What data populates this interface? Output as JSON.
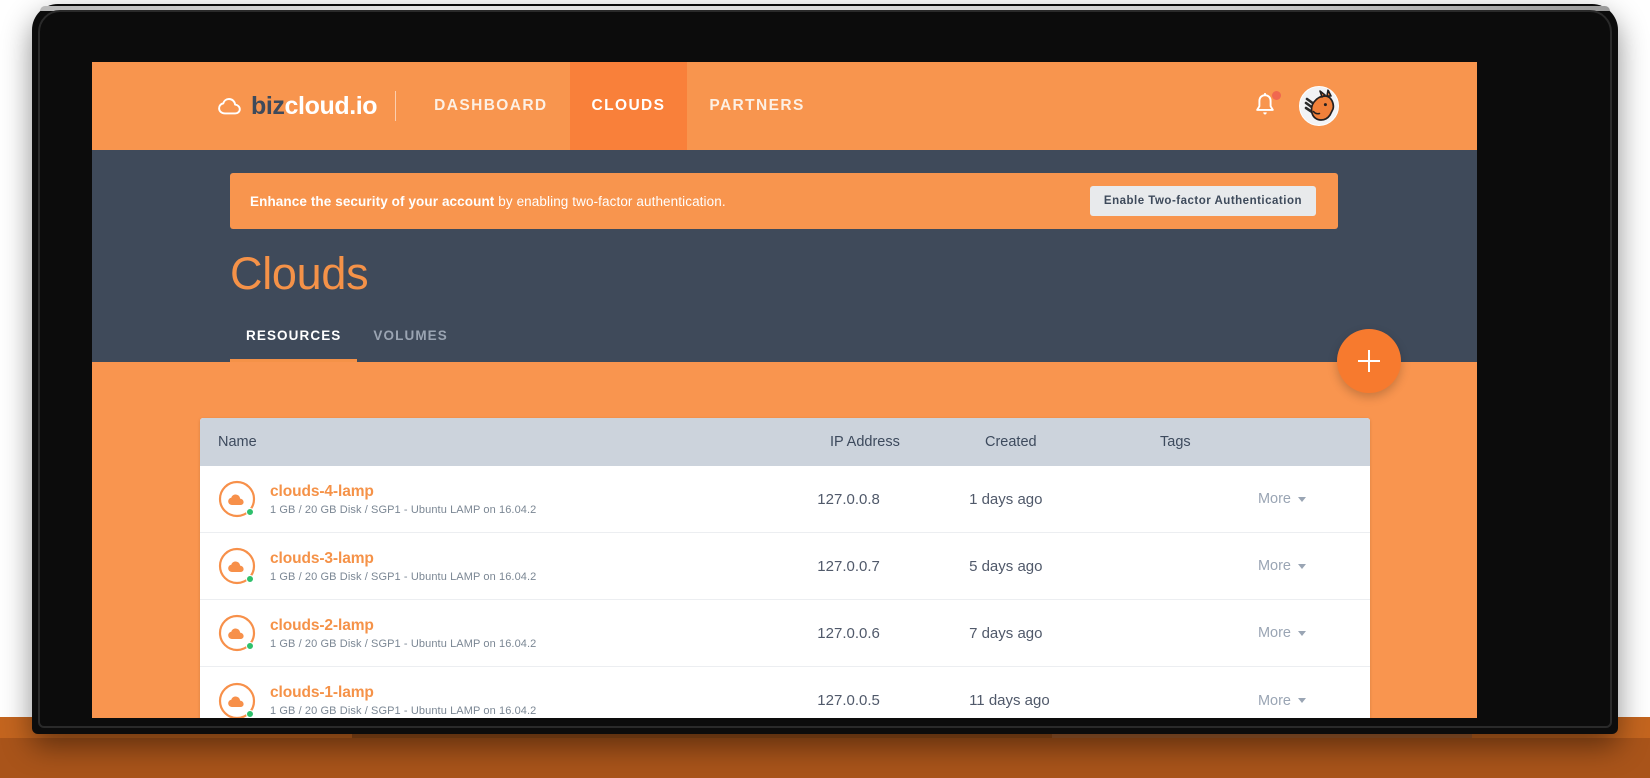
{
  "brand": {
    "mark": "cloud-outline-icon",
    "text_dark": "biz",
    "text_light": "cloud.io"
  },
  "nav": {
    "items": [
      {
        "label": "DASHBOARD",
        "active": false
      },
      {
        "label": "CLOUDS",
        "active": true
      },
      {
        "label": "PARTNERS",
        "active": false
      }
    ],
    "bell_icon": "bell-icon",
    "bell_has_badge": true,
    "avatar_alt": "horse-avatar"
  },
  "banner": {
    "bold_text": "Enhance the security of your account",
    "rest_text": " by enabling two-factor authentication.",
    "button_label": "Enable Two-factor Authentication"
  },
  "page": {
    "title": "Clouds",
    "tabs": [
      {
        "label": "RESOURCES",
        "active": true
      },
      {
        "label": "VOLUMES",
        "active": false
      }
    ],
    "fab_label": "+"
  },
  "table": {
    "columns": [
      "Name",
      "IP Address",
      "Created",
      "Tags",
      ""
    ],
    "rows": [
      {
        "name": "clouds-4-lamp",
        "spec": "1 GB / 20 GB Disk / SGP1 - Ubuntu LAMP on 16.04.2",
        "ip": "127.0.0.8",
        "created": "1 days ago",
        "tags": "",
        "more_label": "More",
        "status": "online"
      },
      {
        "name": "clouds-3-lamp",
        "spec": "1 GB / 20 GB Disk / SGP1 - Ubuntu LAMP on 16.04.2",
        "ip": "127.0.0.7",
        "created": "5 days ago",
        "tags": "",
        "more_label": "More",
        "status": "online"
      },
      {
        "name": "clouds-2-lamp",
        "spec": "1 GB / 20 GB Disk / SGP1 - Ubuntu LAMP on 16.04.2",
        "ip": "127.0.0.6",
        "created": "7 days ago",
        "tags": "",
        "more_label": "More",
        "status": "online"
      },
      {
        "name": "clouds-1-lamp",
        "spec": "1 GB / 20 GB Disk / SGP1 - Ubuntu LAMP on 16.04.2",
        "ip": "127.0.0.5",
        "created": "11 days ago",
        "tags": "",
        "more_label": "More",
        "status": "online"
      }
    ]
  },
  "colors": {
    "brand_orange": "#f8954e",
    "brand_orange_dark": "#f9803a",
    "panel_navy": "#3f4a5a",
    "table_header": "#ccd3dc",
    "accent_text": "#f59248",
    "status_green": "#2ec06c",
    "badge_red": "#f0674f"
  }
}
